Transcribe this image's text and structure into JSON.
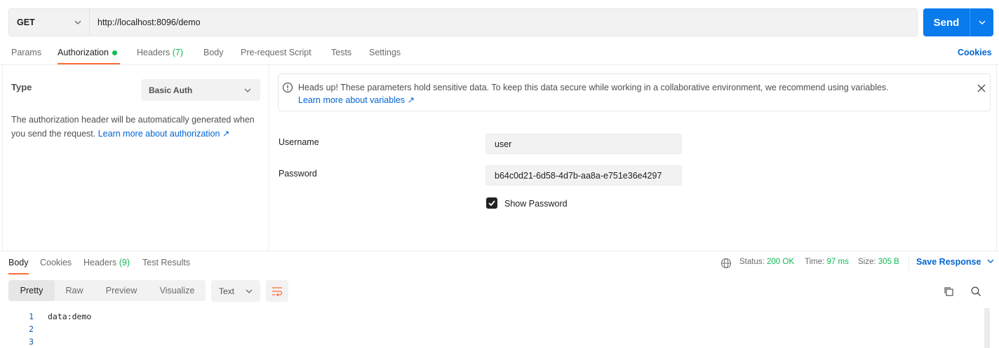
{
  "request": {
    "method": "GET",
    "url": "http://localhost:8096/demo",
    "send_label": "Send"
  },
  "request_tabs": {
    "params": "Params",
    "authorization": "Authorization",
    "headers": "Headers",
    "headers_count": "(7)",
    "body": "Body",
    "prerequest": "Pre-request Script",
    "tests": "Tests",
    "settings": "Settings",
    "cookies": "Cookies"
  },
  "auth": {
    "type_label": "Type",
    "type_value": "Basic Auth",
    "description": "The authorization header will be automatically generated when you send the request.",
    "learn_more": "Learn more about authorization ↗",
    "alert_text": "Heads up! These parameters hold sensitive data. To keep this data secure while working in a collaborative environment, we recommend using variables.",
    "alert_link": "Learn more about variables ↗",
    "username_label": "Username",
    "username_value": "user",
    "password_label": "Password",
    "password_value": "b64c0d21-6d58-4d7b-aa8a-e751e36e4297",
    "show_password_label": "Show Password",
    "show_password_checked": true
  },
  "response": {
    "tabs": {
      "body": "Body",
      "cookies": "Cookies",
      "headers": "Headers",
      "headers_count": "(9)",
      "test_results": "Test Results"
    },
    "status_label": "Status:",
    "status_value": "200 OK",
    "time_label": "Time:",
    "time_value": "97 ms",
    "size_label": "Size:",
    "size_value": "305 B",
    "save_response": "Save Response",
    "views": {
      "pretty": "Pretty",
      "raw": "Raw",
      "preview": "Preview",
      "visualize": "Visualize"
    },
    "format": "Text",
    "line_numbers": [
      "1",
      "2",
      "3"
    ],
    "code_line_1": "data:demo"
  },
  "colors": {
    "accent": "#ff6c37",
    "primary": "#097bed",
    "link": "#0265d2",
    "success": "#0cbb52"
  }
}
